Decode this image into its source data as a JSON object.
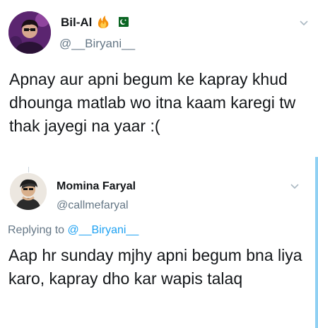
{
  "main_tweet": {
    "display_name": "Bil-Al",
    "handle": "@__Biryani__",
    "text": "Apnay aur apni begum ke kapray khud dhounga matlab wo itna kaam karegi tw thak jayegi na yaar :(",
    "flair_icons": [
      "fire-emoji",
      "pakistan-flag-emoji"
    ]
  },
  "reply_tweet": {
    "display_name": "Momina Faryal",
    "handle": "@callmefaryal",
    "replying_prefix": "Replying to",
    "replying_to": "@__Biryani__",
    "text": "Aap  hr sunday mjhy apni begum bna liya karo, kapray dho kar wapis talaq"
  },
  "colors": {
    "text": "#14171a",
    "muted": "#657786",
    "link": "#1da1f2",
    "accent_bar": "#8fd0f3"
  }
}
